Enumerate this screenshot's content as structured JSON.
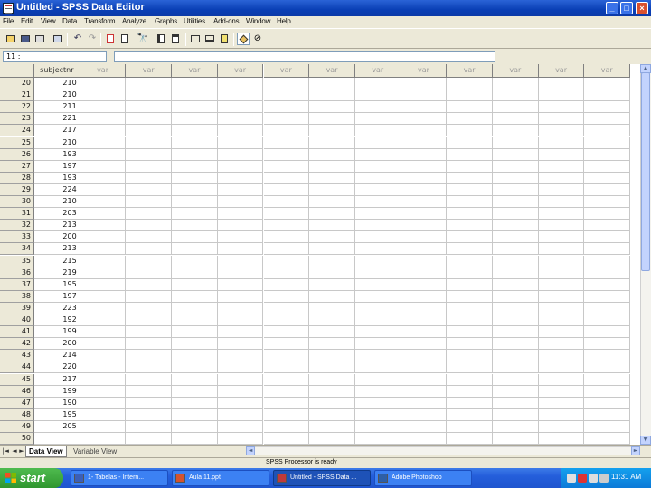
{
  "window": {
    "title": "Untitled - SPSS Data Editor"
  },
  "menu": [
    "File",
    "Edit",
    "View",
    "Data",
    "Transform",
    "Analyze",
    "Graphs",
    "Utilities",
    "Add-ons",
    "Window",
    "Help"
  ],
  "cell_editor": {
    "cell_name": "11 :",
    "value": ""
  },
  "grid": {
    "columns": [
      "subjectnr",
      "var",
      "var",
      "var",
      "var",
      "var",
      "var",
      "var",
      "var",
      "var",
      "var",
      "var",
      "var"
    ],
    "rows": [
      {
        "n": "20",
        "v": "210"
      },
      {
        "n": "21",
        "v": "210"
      },
      {
        "n": "22",
        "v": "211"
      },
      {
        "n": "23",
        "v": "221"
      },
      {
        "n": "24",
        "v": "217"
      },
      {
        "n": "25",
        "v": "210"
      },
      {
        "n": "26",
        "v": "193"
      },
      {
        "n": "27",
        "v": "197"
      },
      {
        "n": "28",
        "v": "193"
      },
      {
        "n": "29",
        "v": "224"
      },
      {
        "n": "30",
        "v": "210"
      },
      {
        "n": "31",
        "v": "203"
      },
      {
        "n": "32",
        "v": "213"
      },
      {
        "n": "33",
        "v": "200"
      },
      {
        "n": "34",
        "v": "213"
      },
      {
        "n": "35",
        "v": "215"
      },
      {
        "n": "36",
        "v": "219"
      },
      {
        "n": "37",
        "v": "195"
      },
      {
        "n": "38",
        "v": "197"
      },
      {
        "n": "39",
        "v": "223"
      },
      {
        "n": "40",
        "v": "192"
      },
      {
        "n": "41",
        "v": "199"
      },
      {
        "n": "42",
        "v": "200"
      },
      {
        "n": "43",
        "v": "214"
      },
      {
        "n": "44",
        "v": "220"
      },
      {
        "n": "45",
        "v": "217"
      },
      {
        "n": "46",
        "v": "199"
      },
      {
        "n": "47",
        "v": "190"
      },
      {
        "n": "48",
        "v": "195"
      },
      {
        "n": "49",
        "v": "205"
      },
      {
        "n": "50",
        "v": ""
      }
    ]
  },
  "tabs": {
    "data_view": "Data View",
    "variable_view": "Variable View"
  },
  "status": "SPSS Processor  is ready",
  "taskbar": {
    "start": "start",
    "items": [
      "1- Tabelas - Intern...",
      "Aula 11.ppt",
      "Untitled - SPSS Data ...",
      "Adobe Photoshop"
    ],
    "clock": "11:31 AM"
  }
}
